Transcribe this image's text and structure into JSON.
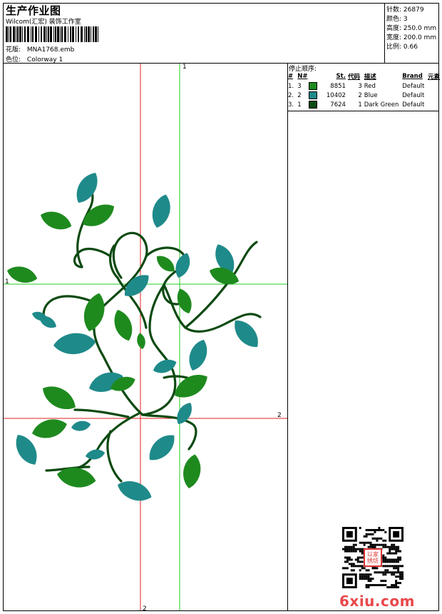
{
  "header": {
    "title": "生产作业图",
    "studio": "Wilcom(汇宏) 装饰工作室",
    "design_label": "花版:",
    "design_value": "MNA1768.emb",
    "colorway_label": "色位:",
    "colorway_value": "Colorway 1"
  },
  "stats": [
    {
      "label": "针数:",
      "value": "26879"
    },
    {
      "label": "颜色:",
      "value": "3"
    },
    {
      "label": "高度:",
      "value": "250.0 mm"
    },
    {
      "label": "宽度:",
      "value": "200.0 mm"
    },
    {
      "label": "比例:",
      "value": "0.66"
    }
  ],
  "stop_sequence": {
    "title": "停止顺序:",
    "columns": [
      "#",
      "N#",
      "St.",
      "代码",
      "描述",
      "Brand",
      "元素"
    ],
    "rows": [
      {
        "index": "1.",
        "n": "3",
        "color": "#1e8a1e",
        "stitches": "8851",
        "code": "3",
        "desc": "Red",
        "brand": "Default",
        "element": ""
      },
      {
        "index": "2.",
        "n": "2",
        "color": "#1f8a8a",
        "stitches": "10402",
        "code": "2",
        "desc": "Blue",
        "brand": "Default",
        "element": ""
      },
      {
        "index": "3.",
        "n": "1",
        "color": "#0d4a12",
        "stitches": "7624",
        "code": "1",
        "desc": "Dark Green",
        "brand": "Default",
        "element": ""
      }
    ]
  },
  "guides": {
    "green_top": "1",
    "green_left": "1",
    "red_right": "2",
    "red_bottom": "2"
  },
  "colors": {
    "green_leaf": "#1e8a1e",
    "teal_leaf": "#1f8a8a",
    "stem": "#0d4a12",
    "guide_red": "#e02020",
    "guide_green": "#22cc22"
  },
  "watermark": "6xiu.com",
  "seal_text": "以家绣坊"
}
